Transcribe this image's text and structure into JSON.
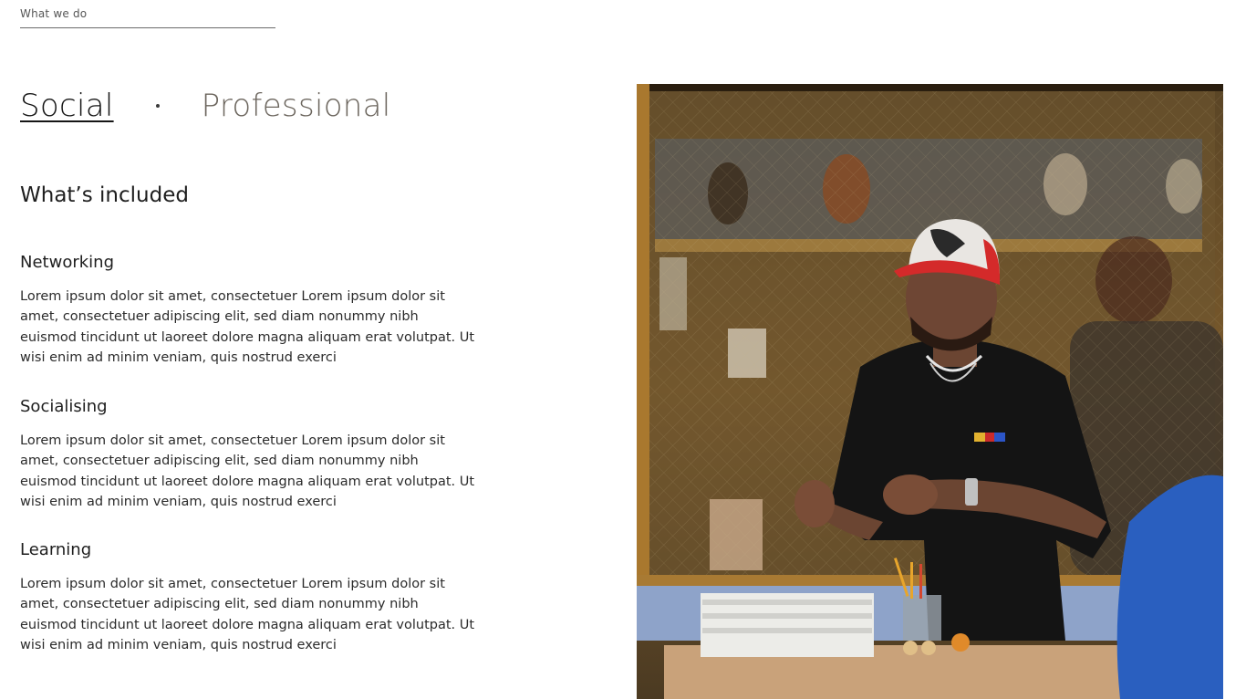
{
  "section_label": "What we do",
  "tabs": [
    {
      "label": "Social",
      "active": true
    },
    {
      "label": "Professional",
      "active": false
    }
  ],
  "included_heading": "What’s included",
  "features": [
    {
      "title": "Networking",
      "body": "Lorem ipsum dolor sit amet, consectetuer Lorem ipsum dolor sit amet, consectetuer adipiscing elit, sed diam nonummy nibh euismod tincidunt ut laoreet dolore magna aliquam erat volutpat. Ut wisi enim ad minim veniam, quis nostrud exerci"
    },
    {
      "title": "Socialising",
      "body": "Lorem ipsum dolor sit amet, consectetuer Lorem ipsum dolor sit amet, consectetuer adipiscing elit, sed diam nonummy nibh euismod tincidunt ut laoreet dolore magna aliquam erat volutpat. Ut wisi enim ad minim veniam, quis nostrud exerci"
    },
    {
      "title": "Learning",
      "body": "Lorem ipsum dolor sit amet, consectetuer Lorem ipsum dolor sit amet, consectetuer adipiscing elit, sed diam nonummy nibh euismod tincidunt ut laoreet dolore magna aliquam erat volutpat. Ut wisi enim ad minim veniam, quis nostrud exerci"
    }
  ],
  "colors": {
    "tab_active": "#161616",
    "tab_inactive": "#6c665e",
    "cap_red": "#d42a2a"
  }
}
